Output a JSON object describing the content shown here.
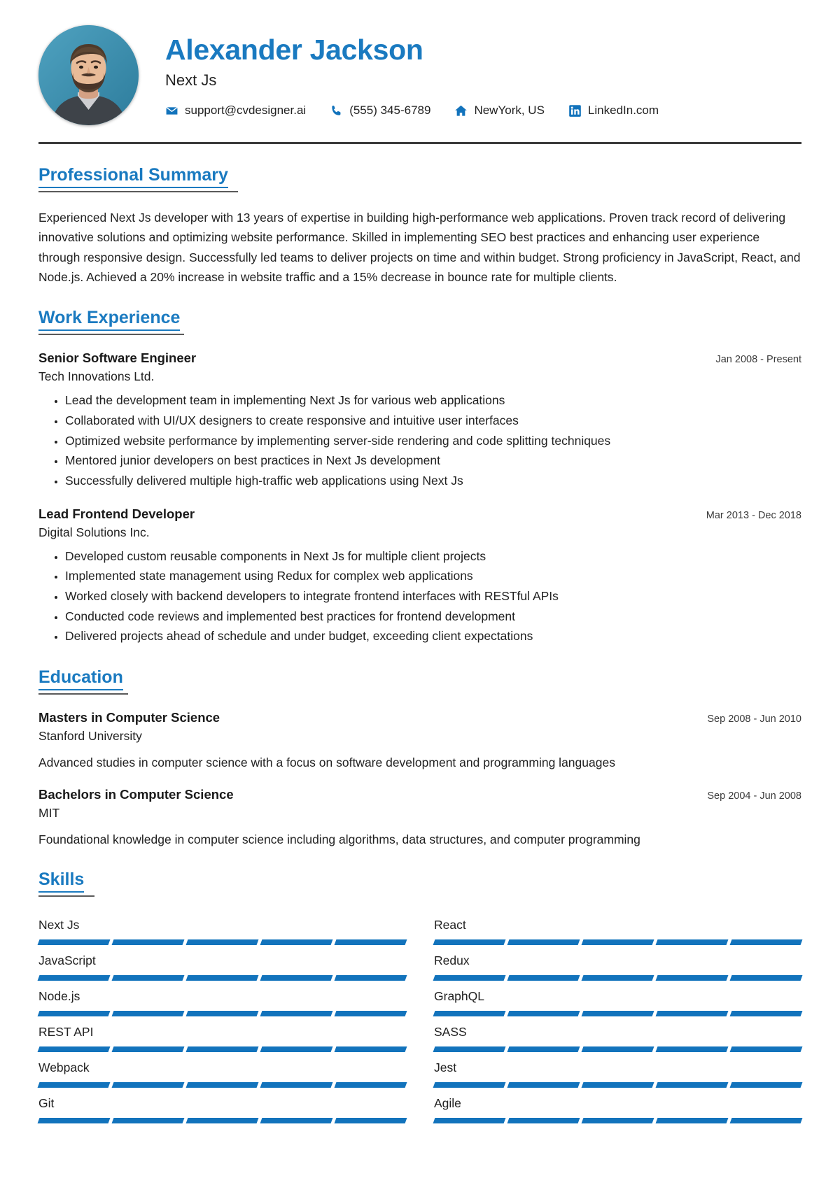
{
  "header": {
    "name": "Alexander Jackson",
    "job_title": "Next Js",
    "avatar_alt": "profile-photo",
    "contacts": [
      {
        "icon": "envelope-icon",
        "text": "support@cvdesigner.ai"
      },
      {
        "icon": "phone-icon",
        "text": "(555) 345-6789"
      },
      {
        "icon": "home-icon",
        "text": "NewYork, US"
      },
      {
        "icon": "linkedin-icon",
        "text": "LinkedIn.com"
      }
    ]
  },
  "summary": {
    "heading": "Professional Summary",
    "text": "Experienced Next Js developer with 13 years of expertise in building high-performance web applications. Proven track record of delivering innovative solutions and optimizing website performance. Skilled in implementing SEO best practices and enhancing user experience through responsive design. Successfully led teams to deliver projects on time and within budget. Strong proficiency in JavaScript, React, and Node.js. Achieved a 20% increase in website traffic and a 15% decrease in bounce rate for multiple clients."
  },
  "work": {
    "heading": "Work Experience",
    "entries": [
      {
        "title": "Senior Software Engineer",
        "date": "Jan 2008 - Present",
        "org": "Tech Innovations Ltd.",
        "bullets": [
          "Lead the development team in implementing Next Js for various web applications",
          "Collaborated with UI/UX designers to create responsive and intuitive user interfaces",
          "Optimized website performance by implementing server-side rendering and code splitting techniques",
          "Mentored junior developers on best practices in Next Js development",
          "Successfully delivered multiple high-traffic web applications using Next Js"
        ]
      },
      {
        "title": "Lead Frontend Developer",
        "date": "Mar 2013 - Dec 2018",
        "org": "Digital Solutions Inc.",
        "bullets": [
          "Developed custom reusable components in Next Js for multiple client projects",
          "Implemented state management using Redux for complex web applications",
          "Worked closely with backend developers to integrate frontend interfaces with RESTful APIs",
          "Conducted code reviews and implemented best practices for frontend development",
          "Delivered projects ahead of schedule and under budget, exceeding client expectations"
        ]
      }
    ]
  },
  "education": {
    "heading": "Education",
    "entries": [
      {
        "degree": "Masters in Computer Science",
        "date": "Sep 2008 - Jun 2010",
        "school": "Stanford University",
        "description": "Advanced studies in computer science with a focus on software development and programming languages"
      },
      {
        "degree": "Bachelors in Computer Science",
        "date": "Sep 2004 - Jun 2008",
        "school": "MIT",
        "description": "Foundational knowledge in computer science including algorithms, data structures, and computer programming"
      }
    ]
  },
  "skills": {
    "heading": "Skills",
    "max_level": 5,
    "items": [
      {
        "name": "Next Js",
        "level": 5
      },
      {
        "name": "React",
        "level": 5
      },
      {
        "name": "JavaScript",
        "level": 5
      },
      {
        "name": "Redux",
        "level": 5
      },
      {
        "name": "Node.js",
        "level": 5
      },
      {
        "name": "GraphQL",
        "level": 5
      },
      {
        "name": "REST API",
        "level": 5
      },
      {
        "name": "SASS",
        "level": 5
      },
      {
        "name": "Webpack",
        "level": 5
      },
      {
        "name": "Jest",
        "level": 5
      },
      {
        "name": "Git",
        "level": 5
      },
      {
        "name": "Agile",
        "level": 5
      }
    ]
  },
  "colors": {
    "accent": "#1a7ac0",
    "skill_bar": "#1273bc",
    "rule_dark": "#3b3b3b",
    "text": "#222222"
  }
}
